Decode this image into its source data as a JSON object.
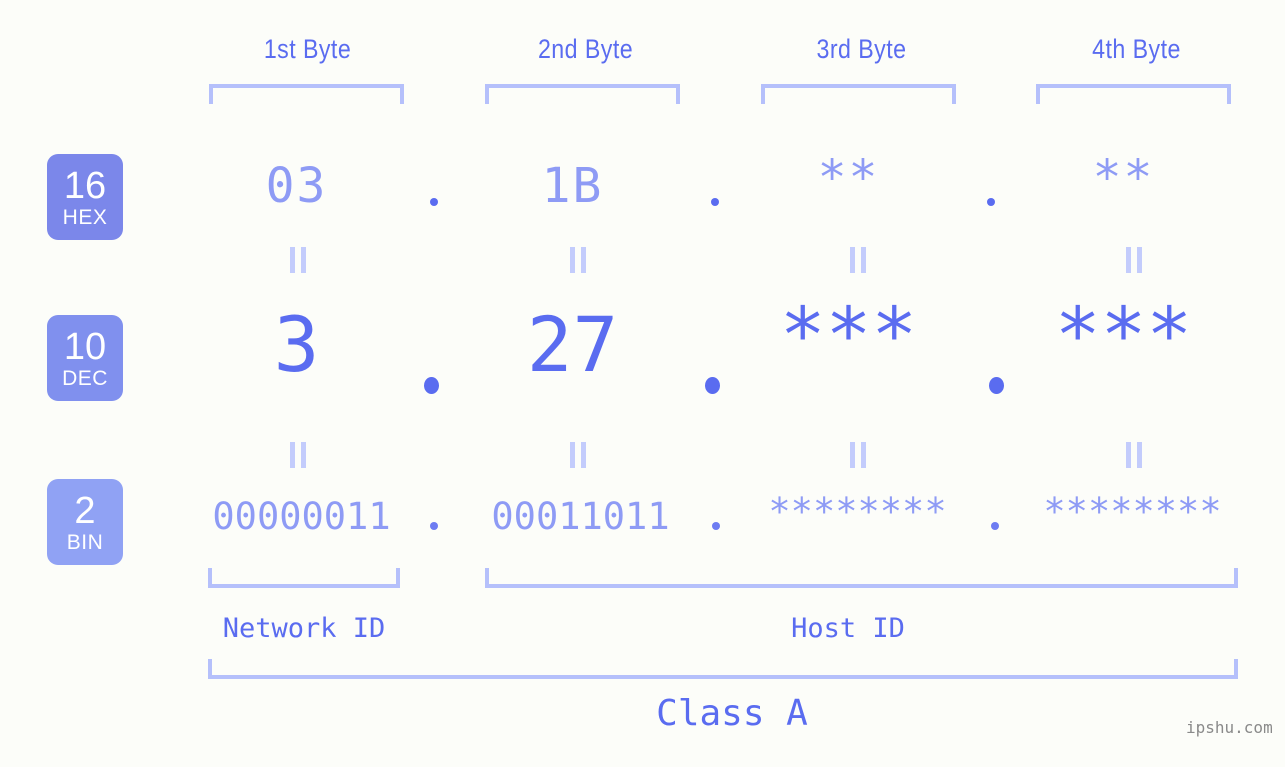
{
  "meta": {
    "background": "#fcfdf9",
    "accent_dark": "#5a6cf0",
    "accent_light": "#8e9bf5",
    "bracket_color": "#b5c0fb",
    "watermark": "ipshu.com"
  },
  "header": {
    "byte_labels": [
      "1st Byte",
      "2nd Byte",
      "3rd Byte",
      "4th Byte"
    ]
  },
  "bases": [
    {
      "num": "16",
      "name": "HEX",
      "color": "#7b87ea"
    },
    {
      "num": "10",
      "name": "DEC",
      "color": "#8090ee"
    },
    {
      "num": "2",
      "name": "BIN",
      "color": "#90a2f4"
    }
  ],
  "rows": {
    "hex": {
      "values": [
        "03",
        "1B",
        "**",
        "**"
      ],
      "separator": "."
    },
    "dec": {
      "values": [
        "3",
        "27",
        "***",
        "***"
      ],
      "separator": "."
    },
    "bin": {
      "values": [
        "00000011",
        "00011011",
        "********",
        "********"
      ],
      "separator": "."
    }
  },
  "connector": "||",
  "footer": {
    "network_id": "Network ID",
    "host_id": "Host ID",
    "class": "Class A"
  }
}
